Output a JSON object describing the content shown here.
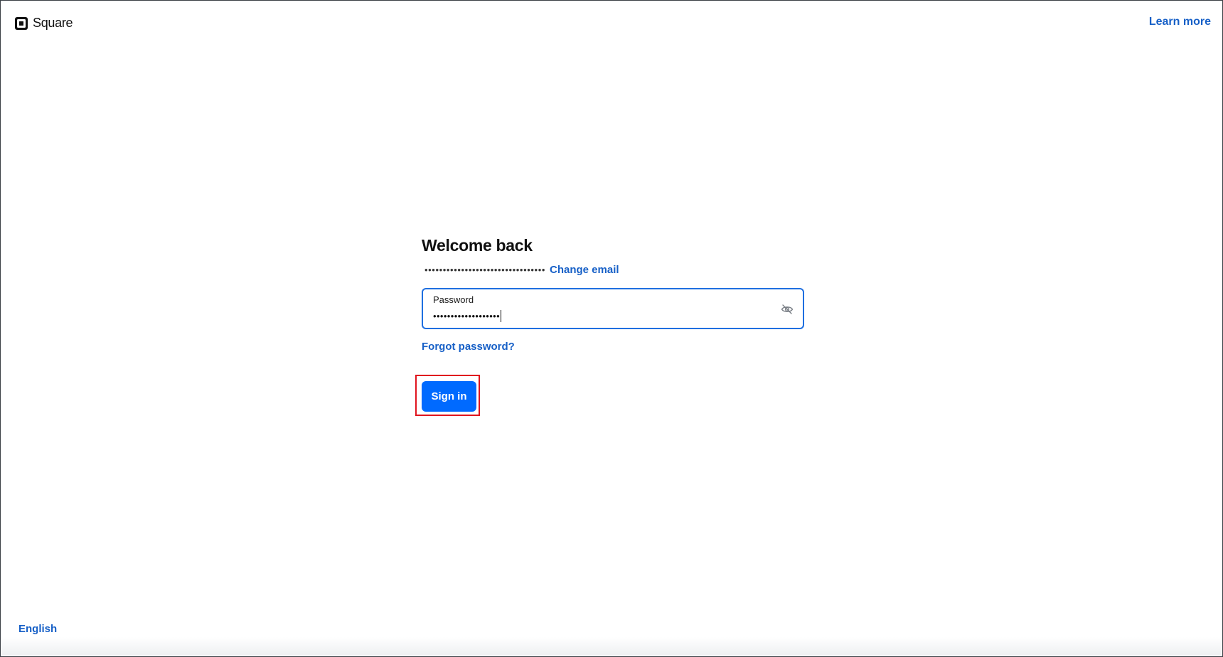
{
  "header": {
    "logo_text": "Square",
    "learn_more_label": "Learn more"
  },
  "signin": {
    "title": "Welcome back",
    "masked_email": "•••••••••••••••••••••••••••••••••",
    "change_email_label": "Change email",
    "password_label": "Password",
    "password_value": "•••••••••••••••••••",
    "forgot_password_label": "Forgot password?",
    "submit_label": "Sign in"
  },
  "footer": {
    "language_label": "English"
  },
  "icons": {
    "logo": "square-logo-icon",
    "password_visibility": "eye-off-icon"
  },
  "colors": {
    "link": "#1760c7",
    "primary_button": "#006aff",
    "focus_border": "#1f6fe0",
    "highlight_box": "#e0141e"
  }
}
